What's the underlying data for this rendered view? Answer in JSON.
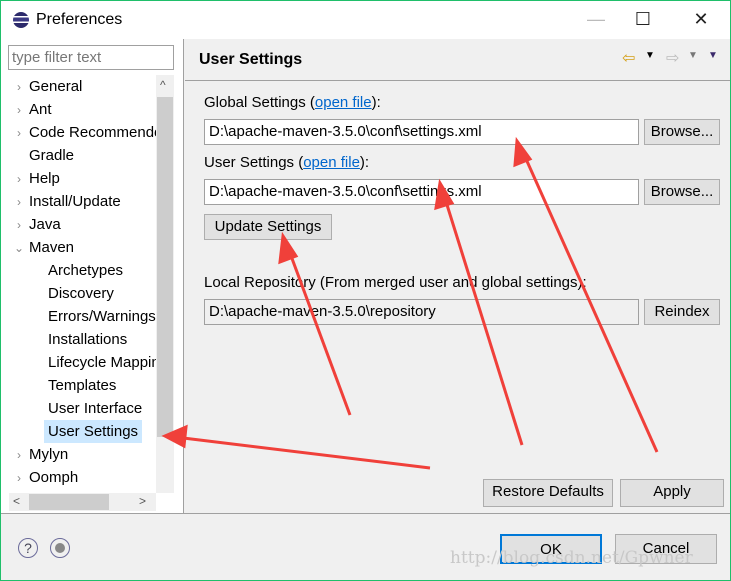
{
  "window": {
    "title": "Preferences",
    "controls": [
      "—",
      "☐",
      "✕"
    ]
  },
  "filter": {
    "placeholder": "type filter text"
  },
  "tree": [
    {
      "label": "General",
      "arrow": "›"
    },
    {
      "label": "Ant",
      "arrow": "›"
    },
    {
      "label": "Code Recommenders",
      "arrow": "›"
    },
    {
      "label": "Gradle",
      "arrow": ""
    },
    {
      "label": "Help",
      "arrow": "›"
    },
    {
      "label": "Install/Update",
      "arrow": "›"
    },
    {
      "label": "Java",
      "arrow": "›"
    },
    {
      "label": "Maven",
      "arrow": "⌄"
    },
    {
      "label": "Archetypes",
      "child": true
    },
    {
      "label": "Discovery",
      "child": true
    },
    {
      "label": "Errors/Warnings",
      "child": true
    },
    {
      "label": "Installations",
      "child": true
    },
    {
      "label": "Lifecycle Mappings",
      "child": true
    },
    {
      "label": "Templates",
      "child": true
    },
    {
      "label": "User Interface",
      "child": true
    },
    {
      "label": "User Settings",
      "child": true,
      "selected": true
    },
    {
      "label": "Mylyn",
      "arrow": "›"
    },
    {
      "label": "Oomph",
      "arrow": "›"
    }
  ],
  "page": {
    "title": "User Settings",
    "global_label": "Global Settings (",
    "global_link": "open file",
    "global_suffix": "):",
    "global_value": "D:\\apache-maven-3.5.0\\conf\\settings.xml",
    "user_label": "User Settings (",
    "user_link": "open file",
    "user_suffix": "):",
    "user_value": "D:\\apache-maven-3.5.0\\conf\\settings.xml",
    "browse": "Browse...",
    "update": "Update Settings",
    "local_label": "Local Repository (From merged user and global settings):",
    "local_value": "D:\\apache-maven-3.5.0\\repository",
    "reindex": "Reindex",
    "restore": "Restore Defaults",
    "apply": "Apply"
  },
  "footer": {
    "ok": "OK",
    "cancel": "Cancel",
    "help_icon": "?"
  },
  "watermark": "http://blog.csdn.net/Gpwner",
  "colors": {
    "arrow": "#f0403a",
    "selection": "#cce8ff",
    "link": "#0066cc"
  }
}
